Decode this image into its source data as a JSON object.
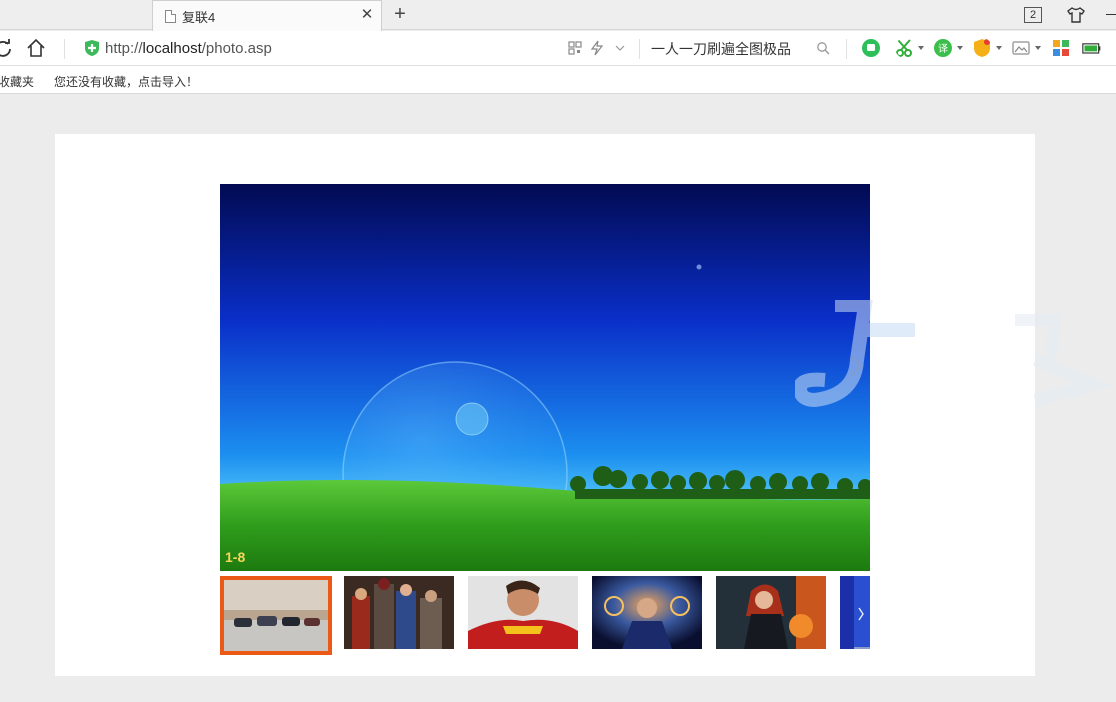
{
  "browser": {
    "tab": {
      "title": "复联4"
    },
    "tab_count": "2",
    "address": {
      "scheme": "http://",
      "host": "localhost",
      "path": "/photo.asp"
    },
    "search": {
      "text": "一人一刀刷遍全图极品"
    },
    "bookmarks": {
      "folder_label": "收藏夹",
      "empty_hint": "您还没有收藏，点击导入！"
    }
  },
  "colors": {
    "accent_orange": "#ea5a16",
    "counter_yellow": "#f5d65a",
    "shield_green": "#3cb95a"
  },
  "slideshow": {
    "counter": "1-8",
    "thumbnails": [
      {
        "name": "cars",
        "active": true
      },
      {
        "name": "avengers-group",
        "active": false
      },
      {
        "name": "soccer-player",
        "active": false
      },
      {
        "name": "doctor-strange",
        "active": false
      },
      {
        "name": "black-widow",
        "active": false
      },
      {
        "name": "blue-partial",
        "active": false
      }
    ]
  }
}
